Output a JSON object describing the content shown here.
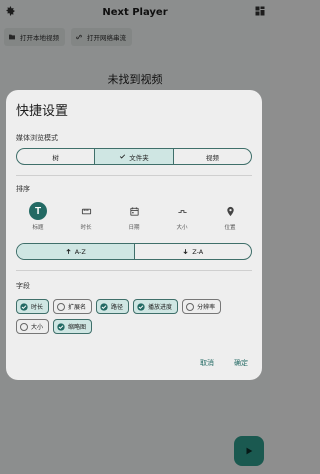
{
  "app": {
    "title": "Next Player",
    "actions": [
      {
        "label": "打开本地视频",
        "icon": "folder-icon"
      },
      {
        "label": "打开网络串流",
        "icon": "link-icon"
      }
    ],
    "empty_text": "未找到视频"
  },
  "dialog": {
    "title": "快捷设置",
    "browse_mode": {
      "label": "媒体浏览模式",
      "options": [
        "树",
        "文件夹",
        "视频"
      ],
      "selected": "文件夹"
    },
    "sort": {
      "label": "排序",
      "options": [
        {
          "label": "标题",
          "icon": "title-t-icon",
          "selected": true
        },
        {
          "label": "时长",
          "icon": "duration-icon",
          "selected": false
        },
        {
          "label": "日期",
          "icon": "calendar-icon",
          "selected": false
        },
        {
          "label": "大小",
          "icon": "size-icon",
          "selected": false
        },
        {
          "label": "位置",
          "icon": "location-pin-icon",
          "selected": false
        }
      ],
      "order_options": [
        {
          "label": "A-Z",
          "icon": "arrow-up-icon",
          "selected": true
        },
        {
          "label": "Z-A",
          "icon": "arrow-down-icon",
          "selected": false
        }
      ]
    },
    "fields": {
      "label": "字段",
      "row1": [
        {
          "label": "时长",
          "checked": true
        },
        {
          "label": "扩展名",
          "checked": false
        },
        {
          "label": "路径",
          "checked": true
        },
        {
          "label": "播放进度",
          "checked": true
        },
        {
          "label": "分辨率",
          "checked": false
        }
      ],
      "row2": [
        {
          "label": "大小",
          "checked": false
        },
        {
          "label": "缩略图",
          "checked": true
        }
      ]
    },
    "cancel_label": "取消",
    "confirm_label": "确定"
  },
  "colors": {
    "accent": "#236a64",
    "selected_bg": "#cfe6e3",
    "fab": "#2e9a8a"
  }
}
